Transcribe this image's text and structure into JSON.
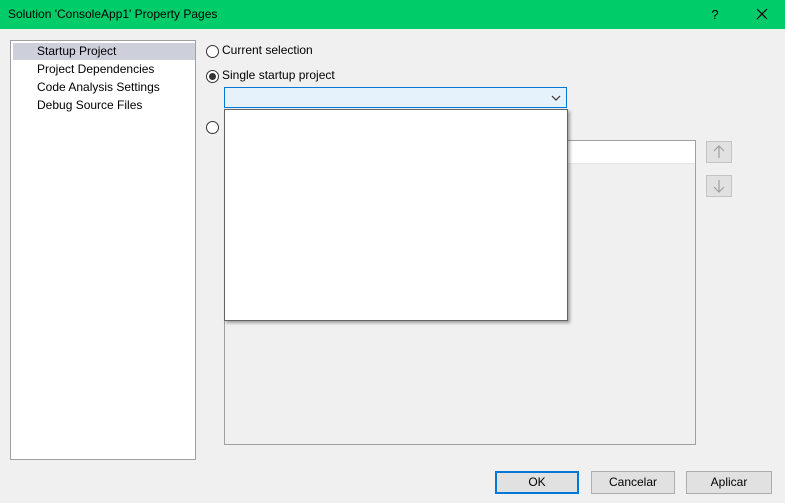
{
  "window": {
    "title": "Solution 'ConsoleApp1' Property Pages",
    "help_label": "?",
    "close_label": "✕",
    "accent_color": "#00cc6a"
  },
  "nav": {
    "items": [
      {
        "label": "Startup Project",
        "selected": true
      },
      {
        "label": "Project Dependencies",
        "selected": false
      },
      {
        "label": "Code Analysis Settings",
        "selected": false
      },
      {
        "label": "Debug Source Files",
        "selected": false
      }
    ]
  },
  "startup": {
    "option_current": "Current selection",
    "option_single": "Single startup project",
    "option_single_checked": true,
    "combo_value": "",
    "dropdown_open": true,
    "dropdown_options": []
  },
  "buttons": {
    "ok": "OK",
    "cancel": "Cancelar",
    "apply": "Aplicar"
  },
  "icons": {
    "move_up": "arrow-up-icon",
    "move_down": "arrow-down-icon",
    "combo_arrow": "chevron-down-icon"
  }
}
